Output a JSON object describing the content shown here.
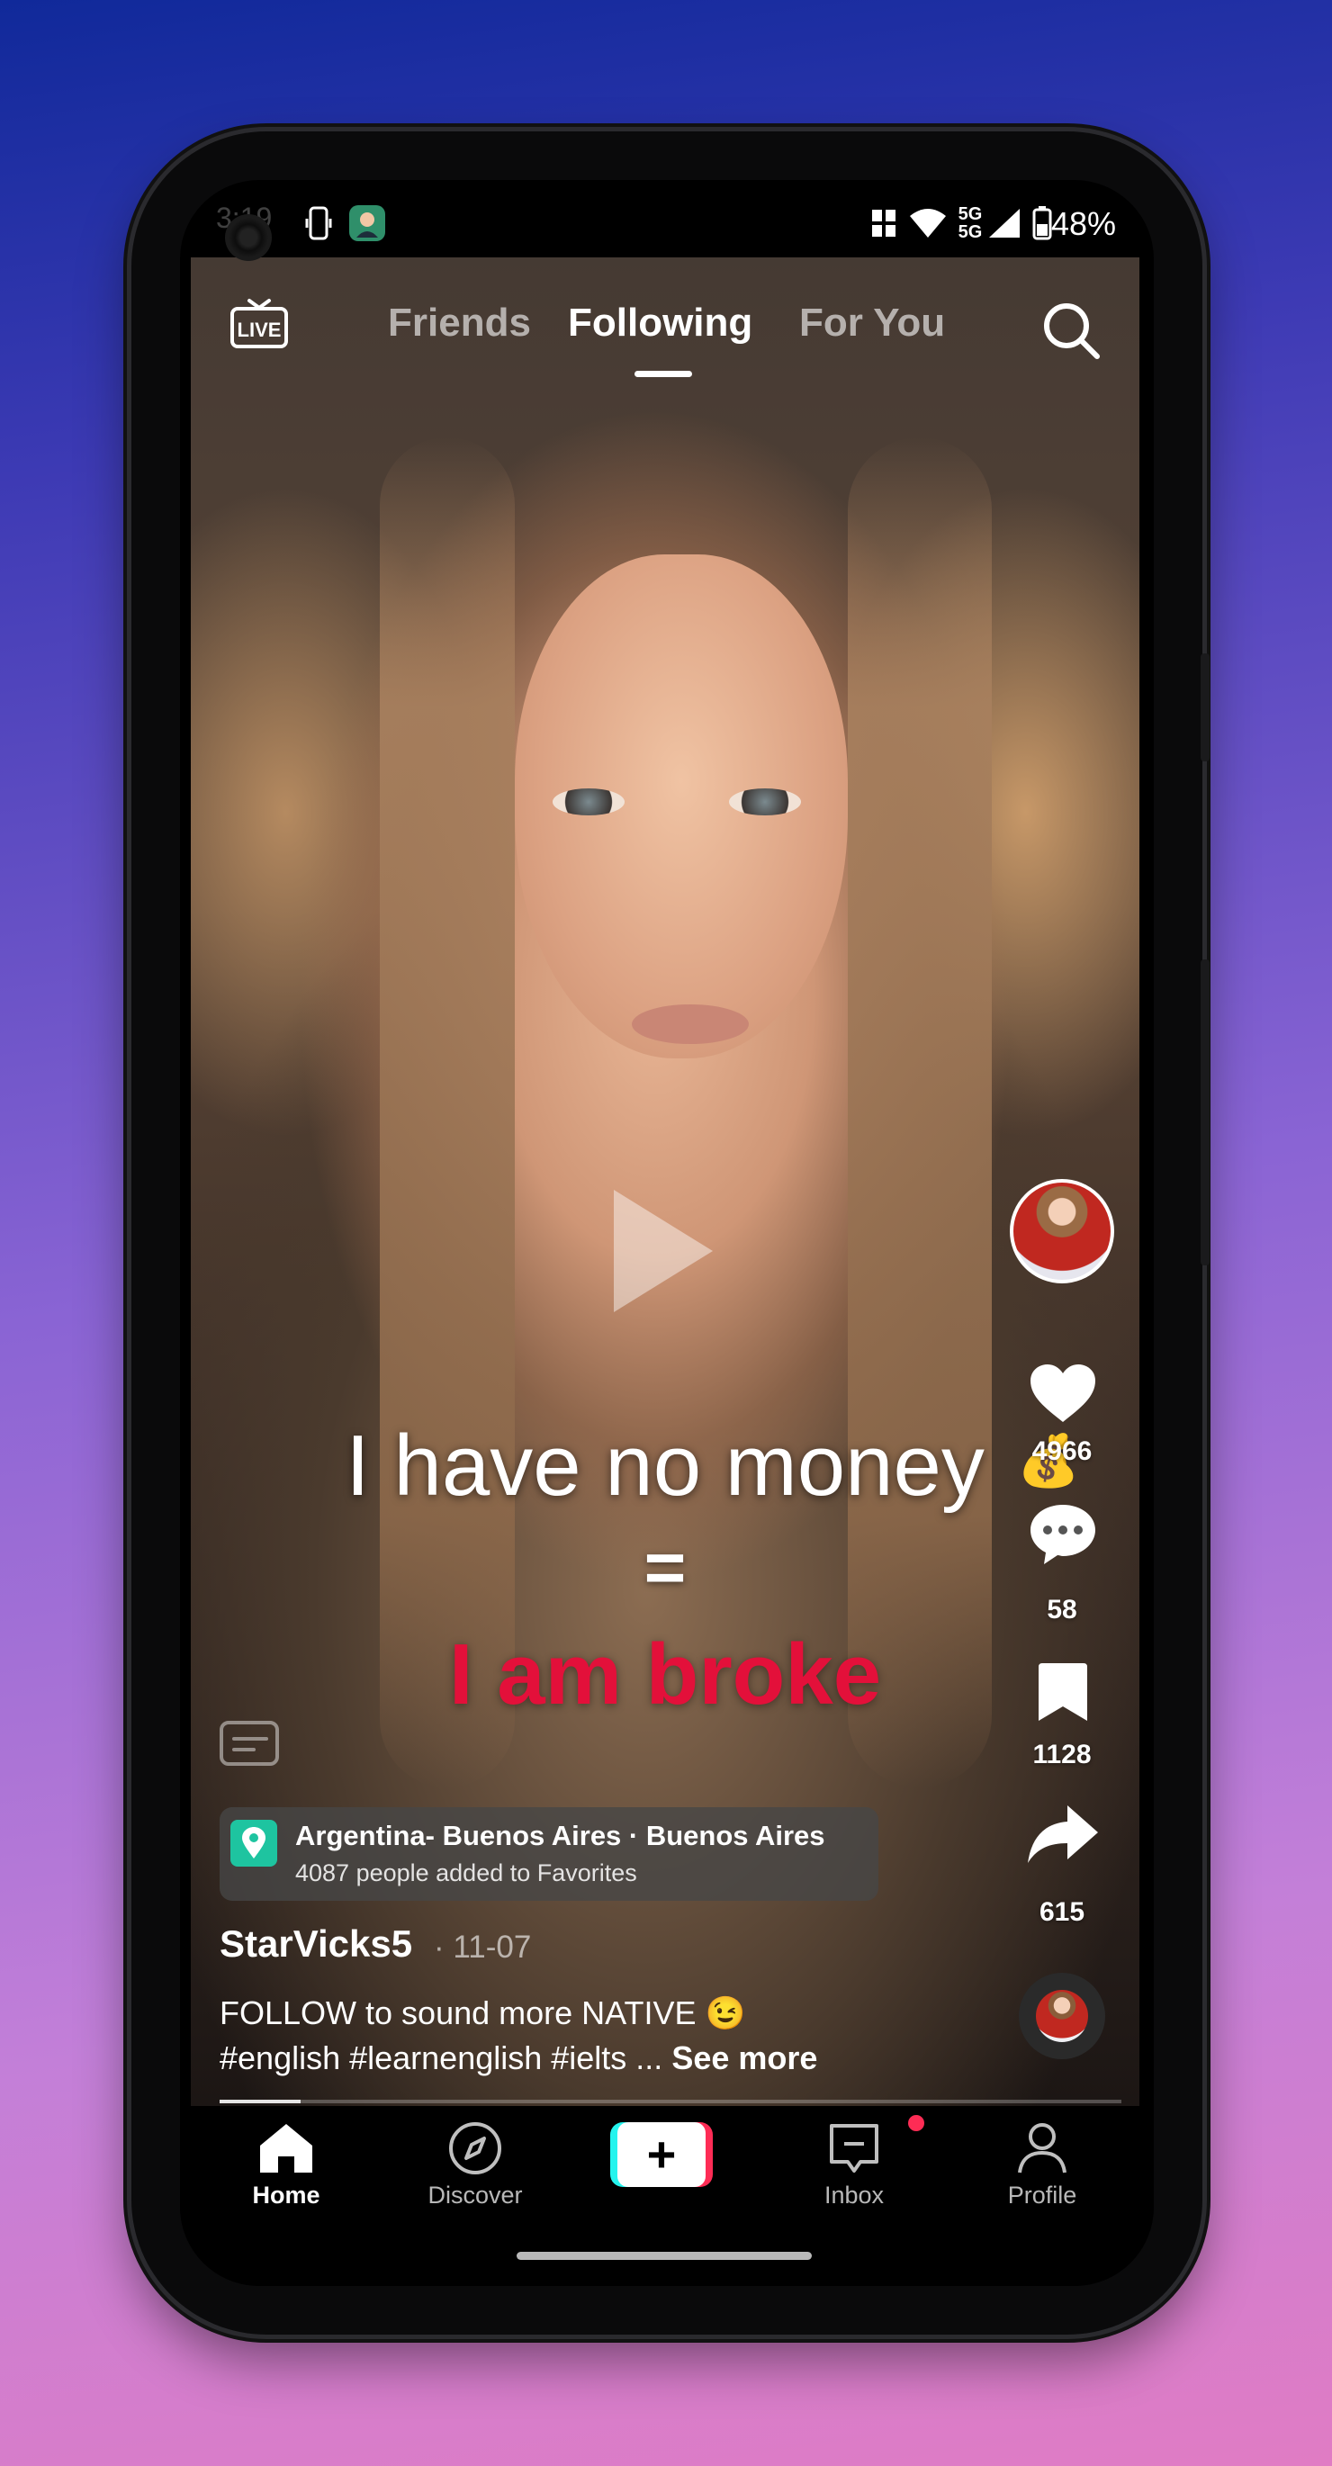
{
  "status_bar": {
    "time": "3:19",
    "network_label_top": "5G",
    "network_label_bottom": "5G",
    "battery_percent": "48%",
    "icons": [
      "phone-sync-icon",
      "app-avatar-icon",
      "vibrate-icon",
      "wifi-icon",
      "signal-icon",
      "battery-icon"
    ]
  },
  "top_tabs": {
    "live_label": "LIVE",
    "tabs": [
      {
        "label": "Friends",
        "selected": false
      },
      {
        "label": "Following",
        "selected": true
      },
      {
        "label": "For You",
        "selected": false
      }
    ]
  },
  "video": {
    "caption_line1": "I have no money",
    "caption_eq": "=",
    "caption_line2": "I am broke",
    "state": "paused"
  },
  "actions": {
    "likes": "4966",
    "comments": "58",
    "bookmarks": "1128",
    "shares": "615",
    "like_emoji": "💰"
  },
  "location": {
    "title": "Argentina- Buenos Aires · Buenos Aires",
    "subtitle": "4087 people added to Favorites"
  },
  "post": {
    "username": "StarVicks5",
    "date": "· 11-07",
    "description_line1": "FOLLOW to sound more NATIVE 😉",
    "description_line2": "#english #learnenglish #ielts ...",
    "see_more": "See more",
    "progress": 0.09
  },
  "bottom_nav": {
    "items": [
      {
        "label": "Home",
        "icon": "home-icon",
        "active": true
      },
      {
        "label": "Discover",
        "icon": "compass-icon",
        "active": false
      },
      {
        "label": "",
        "icon": "plus-icon",
        "active": false
      },
      {
        "label": "Inbox",
        "icon": "inbox-icon",
        "active": false,
        "badge": true
      },
      {
        "label": "Profile",
        "icon": "person-icon",
        "active": false
      }
    ]
  },
  "colors": {
    "accent_pink": "#fe2c55",
    "accent_cyan": "#25f4ee",
    "location_badge": "#1ec4a0",
    "caption_red": "#e3103a"
  }
}
